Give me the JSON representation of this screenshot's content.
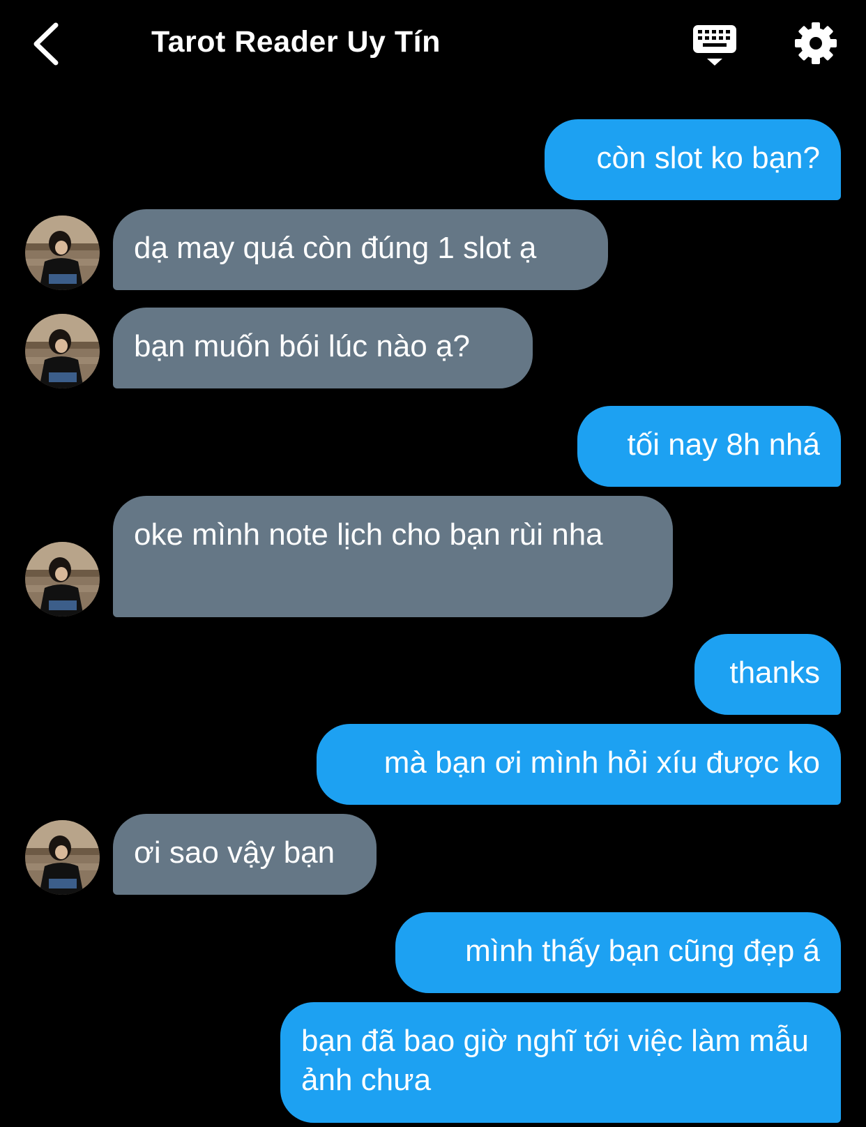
{
  "header": {
    "title": "Tarot Reader Uy Tín",
    "back_icon": "chevron-left-icon",
    "keyboard_icon": "keyboard-icon",
    "settings_icon": "gear-icon"
  },
  "colors": {
    "background": "#000000",
    "outgoing_bubble": "#1da1f2",
    "incoming_bubble": "#657786",
    "text": "#ffffff"
  },
  "messages": [
    {
      "direction": "outgoing",
      "text": "còn slot ko bạn?"
    },
    {
      "direction": "incoming",
      "text": "dạ may quá còn đúng 1 slot ạ"
    },
    {
      "direction": "incoming",
      "text": "bạn muốn bói lúc nào ạ?"
    },
    {
      "direction": "outgoing",
      "text": "tối nay 8h nhá"
    },
    {
      "direction": "incoming",
      "text": "oke mình note lịch cho bạn rùi nha"
    },
    {
      "direction": "outgoing",
      "text": "thanks"
    },
    {
      "direction": "outgoing",
      "text": "mà bạn ơi mình hỏi xíu được ko"
    },
    {
      "direction": "incoming",
      "text": "ơi sao vậy bạn"
    },
    {
      "direction": "outgoing",
      "text": "mình thấy bạn cũng đẹp á"
    },
    {
      "direction": "outgoing",
      "text": "bạn đã bao giờ nghĩ tới việc làm mẫu ảnh chưa"
    }
  ]
}
